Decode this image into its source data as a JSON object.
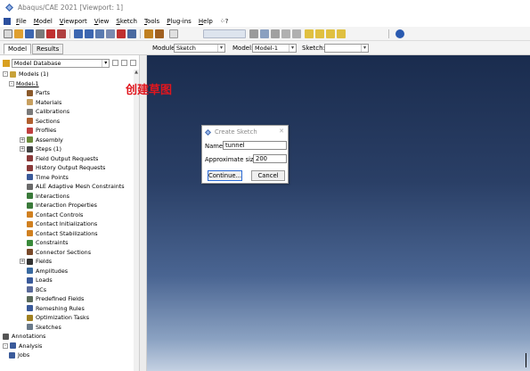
{
  "window": {
    "title": "Abaqus/CAE 2021 [Viewport: 1]"
  },
  "menu": [
    "File",
    "Model",
    "Viewport",
    "View",
    "Sketch",
    "Tools",
    "Plug-ins",
    "Help",
    "⁘?"
  ],
  "tabs": [
    "Model",
    "Results"
  ],
  "context": {
    "module_label": "Module:",
    "module_value": "Sketch",
    "model_label": "Model:",
    "model_value": "Model-1",
    "sketch_label": "Sketch:",
    "sketch_value": ""
  },
  "database": {
    "label": "Model Database"
  },
  "tree": [
    {
      "label": "Models (1)",
      "level": 0,
      "exp": "-",
      "icon": "#c7a23a"
    },
    {
      "label": "Model-1",
      "level": 1,
      "exp": "-",
      "icon": "",
      "underline": true
    },
    {
      "label": "Parts",
      "level": 2,
      "icon": "#8b5a2b"
    },
    {
      "label": "Materials",
      "level": 2,
      "icon": "#c8a060"
    },
    {
      "label": "Calibrations",
      "level": 2,
      "icon": "#7a7a7a"
    },
    {
      "label": "Sections",
      "level": 2,
      "icon": "#b06030"
    },
    {
      "label": "Profiles",
      "level": 2,
      "icon": "#c04040"
    },
    {
      "label": "Assembly",
      "level": 2,
      "exp": "+",
      "icon": "#6a8a3a"
    },
    {
      "label": "Steps (1)",
      "level": 2,
      "exp": "+",
      "icon": "#444444"
    },
    {
      "label": "Field Output Requests",
      "level": 2,
      "icon": "#8a3a3a"
    },
    {
      "label": "History Output Requests",
      "level": 2,
      "icon": "#8a3a3a"
    },
    {
      "label": "Time Points",
      "level": 2,
      "icon": "#3a5a9a"
    },
    {
      "label": "ALE Adaptive Mesh Constraints",
      "level": 2,
      "icon": "#6a6a6a"
    },
    {
      "label": "Interactions",
      "level": 2,
      "icon": "#3a7a3a"
    },
    {
      "label": "Interaction Properties",
      "level": 2,
      "icon": "#3a7a3a"
    },
    {
      "label": "Contact Controls",
      "level": 2,
      "icon": "#d08020"
    },
    {
      "label": "Contact Initializations",
      "level": 2,
      "icon": "#d08020"
    },
    {
      "label": "Contact Stabilizations",
      "level": 2,
      "icon": "#d08020"
    },
    {
      "label": "Constraints",
      "level": 2,
      "icon": "#3a8a3a"
    },
    {
      "label": "Connector Sections",
      "level": 2,
      "icon": "#7a4a2a"
    },
    {
      "label": "Fields",
      "level": 2,
      "exp": "+",
      "icon": "#333333"
    },
    {
      "label": "Amplitudes",
      "level": 2,
      "icon": "#3a6aa0"
    },
    {
      "label": "Loads",
      "level": 2,
      "icon": "#3a5a9a"
    },
    {
      "label": "BCs",
      "level": 2,
      "icon": "#5a6a9a"
    },
    {
      "label": "Predefined Fields",
      "level": 2,
      "icon": "#5a6a5a"
    },
    {
      "label": "Remeshing Rules",
      "level": 2,
      "icon": "#3a5a9a"
    },
    {
      "label": "Optimization Tasks",
      "level": 2,
      "icon": "#a08020"
    },
    {
      "label": "Sketches",
      "level": 2,
      "icon": "#6a7a8a"
    },
    {
      "label": "Annotations",
      "level": 0,
      "icon": "#555555"
    },
    {
      "label": "Analysis",
      "level": 0,
      "exp": "-",
      "icon": "#3a5a9a"
    },
    {
      "label": "Jobs",
      "level": 1,
      "icon": "#3a5a9a"
    }
  ],
  "annotation": "创建草图",
  "dialog": {
    "title": "Create Sketch",
    "name_label": "Name:",
    "name_value": "tunnel",
    "size_label": "Approximate size:",
    "size_value": "200",
    "continue_label": "Continue...",
    "cancel_label": "Cancel"
  },
  "colors": {
    "annotation": "#e0161e",
    "viewport_top": "#1a2c4e",
    "viewport_bottom": "#c4d1e2"
  }
}
